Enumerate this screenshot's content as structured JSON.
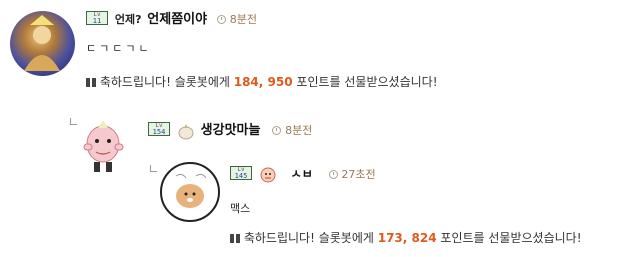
{
  "comments": [
    {
      "nick_prefix": "언제?",
      "nick": "언제쯤이야",
      "time": "8분전",
      "body": "ㄷㄱㄷㄱㄴ",
      "gift": {
        "before": "축하드립니다! 슬롯봇에게",
        "points": "184, 950",
        "after": "포인트를 선물받으셨습니다!"
      }
    },
    {
      "nick": "생강맛마늘",
      "time": "8분전"
    },
    {
      "nick": "ㅅㅂ",
      "time": "27초전",
      "body": "맥스",
      "gift": {
        "before": "축하드립니다! 슬롯봇에게",
        "points": "173, 824",
        "after": "포인트를 선물받으셨습니다!"
      }
    }
  ],
  "colors": {
    "points": "#e05a1c",
    "time": "#9b7a55"
  }
}
